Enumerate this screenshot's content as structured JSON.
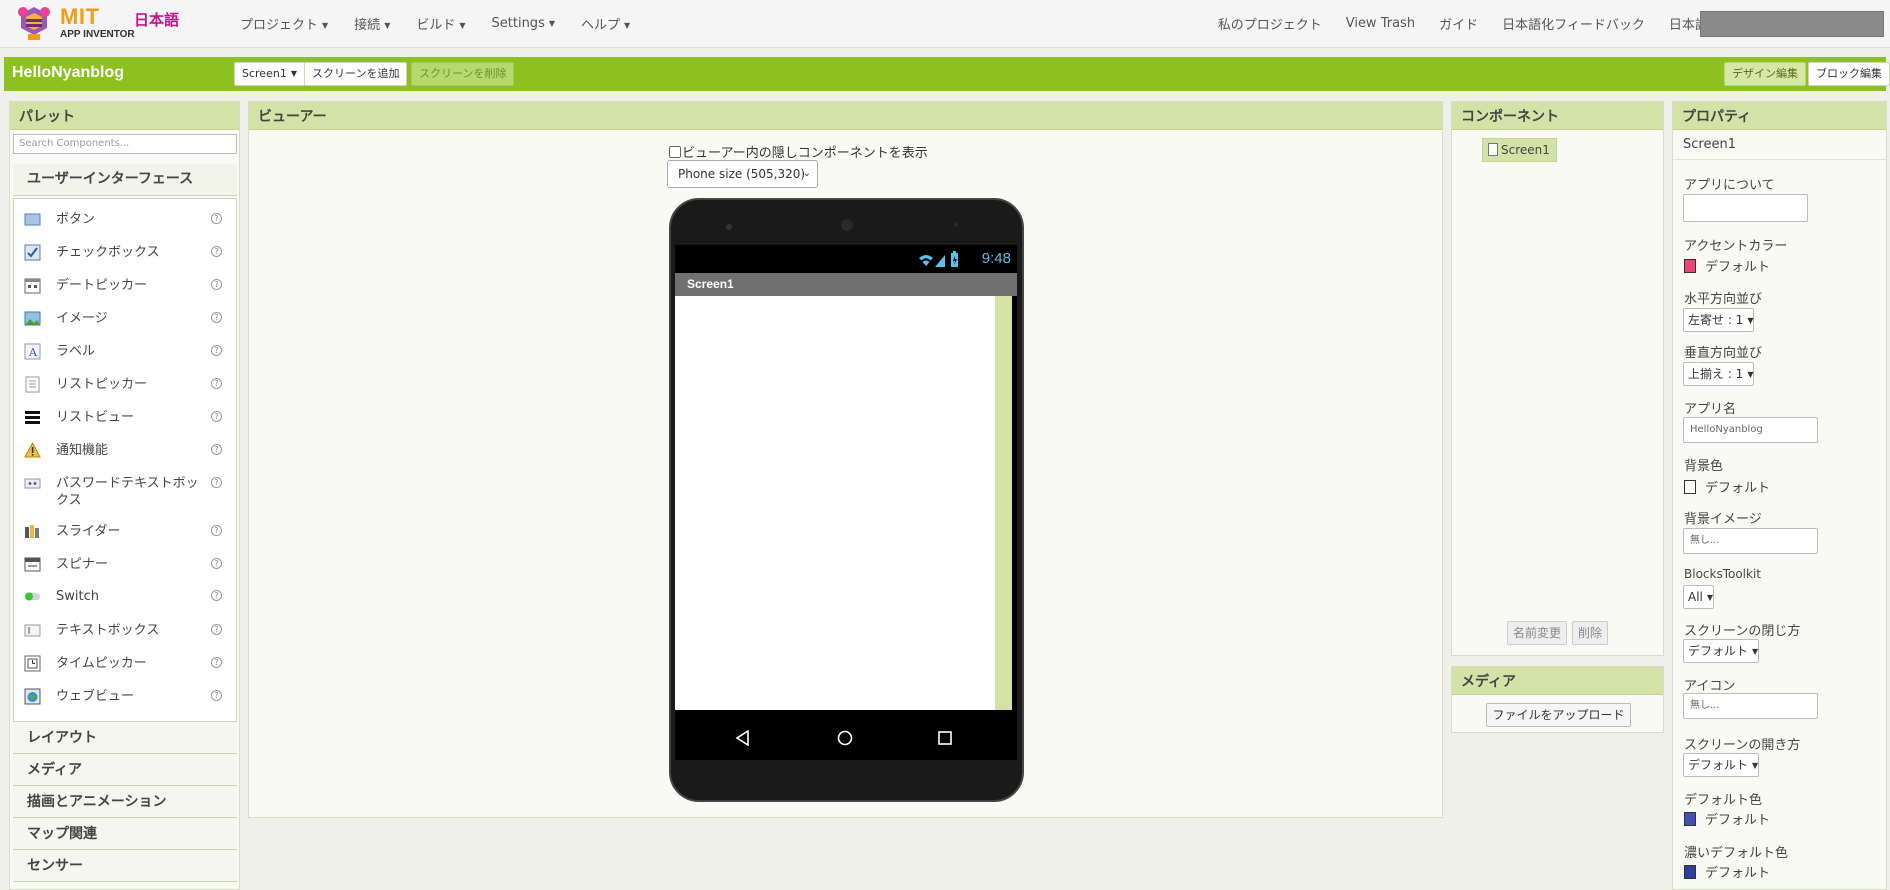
{
  "logo": {
    "mark_text": "MIT",
    "sub_text": "APP INVENTOR",
    "lang_text": "日本語"
  },
  "topnav": {
    "left": [
      {
        "label": "プロジェクト"
      },
      {
        "label": "接続"
      },
      {
        "label": "ビルド"
      },
      {
        "label": "Settings"
      },
      {
        "label": "ヘルプ"
      }
    ],
    "right": {
      "my_projects": "私のプロジェクト",
      "view_trash": "View Trash",
      "guide": "ガイド",
      "feedback": "日本語化フィードバック",
      "language": "日本語"
    }
  },
  "toolbar": {
    "project_name": "HelloNyanblog",
    "screen_select": "Screen1",
    "add_screen": "スクリーンを追加",
    "remove_screen": "スクリーンを削除",
    "designer": "デザイン編集",
    "blocks": "ブロック編集"
  },
  "palette": {
    "title": "パレット",
    "search_placeholder": "Search Components...",
    "category_ui": "ユーザーインターフェース",
    "items": [
      {
        "label": "ボタン",
        "icon": "button-icon"
      },
      {
        "label": "チェックボックス",
        "icon": "checkbox-icon"
      },
      {
        "label": "デートピッカー",
        "icon": "datepicker-icon"
      },
      {
        "label": "イメージ",
        "icon": "image-icon"
      },
      {
        "label": "ラベル",
        "icon": "label-icon"
      },
      {
        "label": "リストピッカー",
        "icon": "listpicker-icon"
      },
      {
        "label": "リストビュー",
        "icon": "listview-icon"
      },
      {
        "label": "通知機能",
        "icon": "notifier-icon"
      },
      {
        "label": "パスワードテキストボックス",
        "icon": "password-icon"
      },
      {
        "label": "スライダー",
        "icon": "slider-icon"
      },
      {
        "label": "スピナー",
        "icon": "spinner-icon"
      },
      {
        "label": "Switch",
        "icon": "switch-icon"
      },
      {
        "label": "テキストボックス",
        "icon": "textbox-icon"
      },
      {
        "label": "タイムピッカー",
        "icon": "timepicker-icon"
      },
      {
        "label": "ウェブビュー",
        "icon": "webview-icon"
      }
    ],
    "help_glyph": "?",
    "categories": [
      {
        "label": "レイアウト"
      },
      {
        "label": "メディア"
      },
      {
        "label": "描画とアニメーション"
      },
      {
        "label": "マップ関連"
      },
      {
        "label": "センサー"
      }
    ]
  },
  "viewer": {
    "title": "ビューアー",
    "hidden_toggle": "ビューアー内の隠しコンポーネントを表示",
    "phone_size": "Phone size (505,320)",
    "clock": "9:48",
    "screen_title": "Screen1"
  },
  "components": {
    "title": "コンポーネント",
    "root": "Screen1",
    "rename": "名前変更",
    "delete": "削除"
  },
  "media": {
    "title": "メディア",
    "upload": "ファイルをアップロード"
  },
  "properties": {
    "title": "プロパティ",
    "component": "Screen1",
    "about_label": "アプリについて",
    "accent_label": "アクセントカラー",
    "accent_value": "デフォルト",
    "accent_color": "#e8457a",
    "align_h_label": "水平方向並び",
    "align_h_value": "左寄せ : 1",
    "align_v_label": "垂直方向並び",
    "align_v_value": "上揃え : 1",
    "appname_label": "アプリ名",
    "appname_value": "HelloNyanblog",
    "bgcolor_label": "背景色",
    "bgcolor_value": "デフォルト",
    "bgcolor_color": "#ffffff",
    "bgimage_label": "背景イメージ",
    "bgimage_value": "無し...",
    "toolkit_label": "BlocksToolkit",
    "toolkit_value": "All",
    "close_anim_label": "スクリーンの閉じ方",
    "close_anim_value": "デフォルト",
    "icon_label": "アイコン",
    "icon_value": "無し...",
    "open_anim_label": "スクリーンの開き方",
    "open_anim_value": "デフォルト",
    "primary_label": "デフォルト色",
    "primary_value": "デフォルト",
    "primary_color": "#3f51b5",
    "primary_dark_label": "濃いデフォルト色",
    "primary_dark_value": "デフォルト",
    "primary_dark_color": "#303f9f"
  },
  "colors": {
    "toolbar_green": "#8dc11f",
    "panel_header": "#d3e2a7",
    "logo_orange": "#f39c12",
    "logo_magenta": "#c0158b"
  }
}
